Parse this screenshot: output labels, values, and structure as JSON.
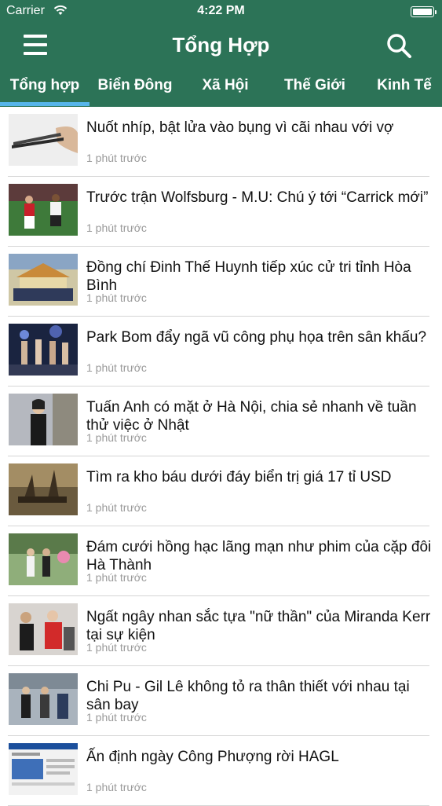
{
  "status": {
    "carrier": "Carrier",
    "time": "4:22 PM"
  },
  "nav": {
    "title": "Tổng Hợp",
    "menu_icon": "hamburger-icon",
    "search_icon": "search-icon"
  },
  "tabs": [
    {
      "label": "Tổng hợp",
      "active": true
    },
    {
      "label": "Biển Đông"
    },
    {
      "label": "Xã Hội"
    },
    {
      "label": "Thế Giới"
    },
    {
      "label": "Kinh Tế"
    }
  ],
  "colors": {
    "header": "#2c7357",
    "tab_indicator": "#56b5ea",
    "time_text": "#9a9a9a"
  },
  "articles": [
    {
      "title": "Nuốt nhíp, bật lửa vào bụng vì cãi nhau với vợ",
      "time": "1 phút trước"
    },
    {
      "title": "Trước trận Wolfsburg - M.U: Chú ý tới “Carrick mới”",
      "time": "1 phút trước"
    },
    {
      "title": "Đồng chí Đinh Thế Huynh tiếp xúc cử tri tỉnh Hòa Bình",
      "time": "1 phút trước"
    },
    {
      "title": "Park Bom đẩy ngã vũ công phụ họa trên sân khấu?",
      "time": "1 phút trước"
    },
    {
      "title": "Tuấn Anh có mặt ở Hà Nội, chia sẻ nhanh về tuần thử việc ở Nhật",
      "time": "1 phút trước"
    },
    {
      "title": "Tìm ra kho báu dưới đáy biển trị giá 17 tỉ USD",
      "time": "1 phút trước"
    },
    {
      "title": "Đám cưới hồng hạc lãng mạn như phim của cặp đôi Hà Thành",
      "time": "1 phút trước"
    },
    {
      "title": "Ngất ngây nhan sắc tựa \"nữ thần\" của Miranda Kerr tại sự kiện",
      "time": "1 phút trước"
    },
    {
      "title": "Chi Pu - Gil Lê không tỏ ra thân thiết với nhau tại sân bay",
      "time": "1 phút trước"
    },
    {
      "title": "Ấn định ngày Công Phượng rời HAGL",
      "time": "1 phút trước"
    }
  ]
}
